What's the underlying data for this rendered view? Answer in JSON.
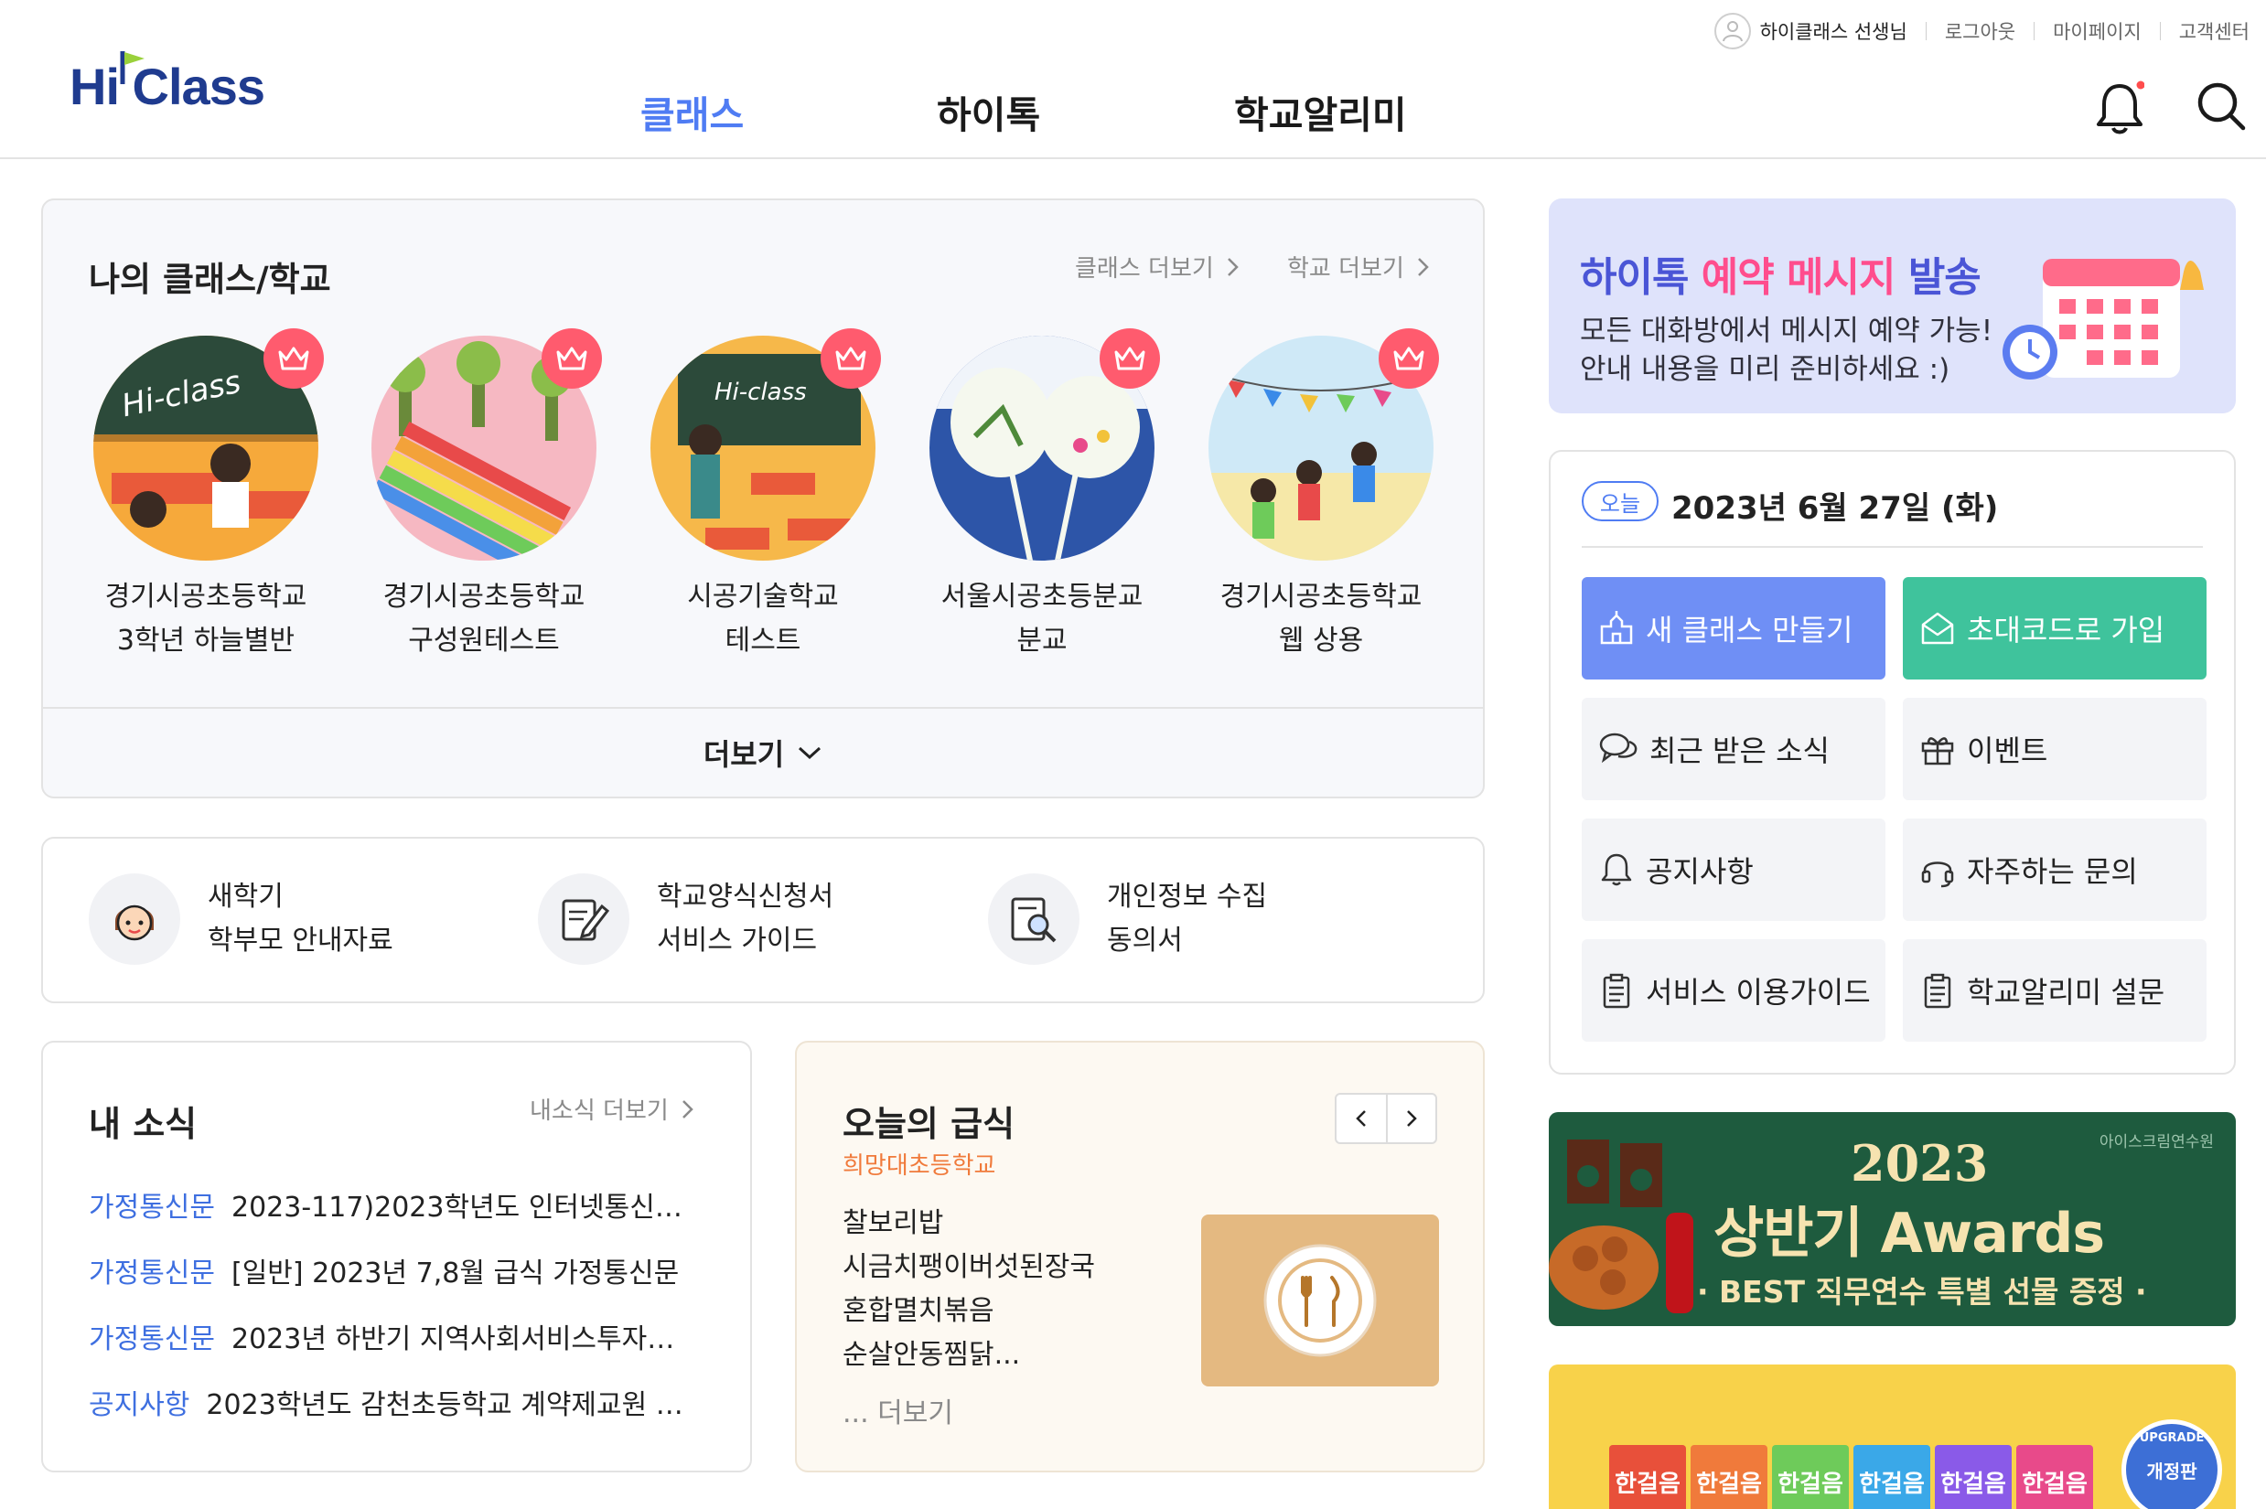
{
  "header": {
    "user": "하이클래스 선생님",
    "links": [
      "로그아웃",
      "마이페이지",
      "고객센터"
    ],
    "logo": "Hi Class",
    "nav": [
      "클래스",
      "하이톡",
      "학교알리미"
    ],
    "active_nav": "클래스"
  },
  "my_classes": {
    "title": "나의 클래스/학교",
    "class_more": "클래스 더보기",
    "school_more": "학교 더보기",
    "items": [
      {
        "line1": "경기시공초등학교",
        "line2": "3학년 하늘별반"
      },
      {
        "line1": "경기시공초등학교",
        "line2": "구성원테스트"
      },
      {
        "line1": "시공기술학교",
        "line2": "테스트"
      },
      {
        "line1": "서울시공초등분교",
        "line2": "분교"
      },
      {
        "line1": "경기시공초등학교",
        "line2": "웹 상용"
      }
    ],
    "more": "더보기",
    "art_text": [
      "Hi-class",
      "Hi-class"
    ]
  },
  "guides": [
    {
      "line1": "새학기",
      "line2": "학부모 안내자료",
      "icon": "face-icon"
    },
    {
      "line1": "학교양식신청서",
      "line2": "서비스 가이드",
      "icon": "form-edit-icon"
    },
    {
      "line1": "개인정보 수집",
      "line2": "동의서",
      "icon": "document-search-icon"
    }
  ],
  "news": {
    "title": "내 소식",
    "more": "내소식 더보기",
    "rows": [
      {
        "category": "가정통신문",
        "text": "2023-117)2023학년도 인터넷통신…"
      },
      {
        "category": "가정통신문",
        "text": "[일반] 2023년 7,8월 급식 가정통신문"
      },
      {
        "category": "가정통신문",
        "text": "2023년 하반기 지역사회서비스투자…"
      },
      {
        "category": "공지사항",
        "text": "2023학년도 감천초등학교 계약제교원 …"
      }
    ]
  },
  "meal": {
    "title": "오늘의 급식",
    "school": "희망대초등학교",
    "menu": [
      "찰보리밥",
      "시금치팽이버섯된장국",
      "혼합멸치볶음",
      "순살안동찜닭..."
    ],
    "more": "... 더보기"
  },
  "banner_reserve": {
    "title_a": "하이톡",
    "title_b": "예약 메시지",
    "title_c": "발송",
    "line1": "모든 대화방에서 메시지 예약 가능!",
    "line2": "안내 내용을 미리 준비하세요 :)"
  },
  "today": {
    "badge": "오늘",
    "date": "2023년 6월 27일 (화)",
    "buttons": [
      {
        "label": "새 클래스 만들기",
        "icon": "school-icon"
      },
      {
        "label": "초대코드로 가입",
        "icon": "mail-open-icon"
      },
      {
        "label": "최근 받은 소식",
        "icon": "chat-bubbles-icon"
      },
      {
        "label": "이벤트",
        "icon": "gift-icon"
      },
      {
        "label": "공지사항",
        "icon": "bell-icon"
      },
      {
        "label": "자주하는 문의",
        "icon": "headset-icon"
      },
      {
        "label": "서비스 이용가이드",
        "icon": "clipboard-icon"
      },
      {
        "label": "학교알리미 설문",
        "icon": "clipboard-icon"
      }
    ]
  },
  "banner_awards": {
    "org": "아이스크림연수원",
    "year": "2023",
    "title": "상반기 Awards",
    "subtitle": "· BEST 직무연수 특별 선물 증정 ·"
  },
  "banner_books": {
    "badge_top": "UPGRADE",
    "badge": "개정판",
    "book_text": "한걸음"
  },
  "colors": {
    "brand": "#1f3b8f",
    "accent": "#4f7cf3",
    "crown": "#ff5b6e",
    "news_category": "#3e6fe0",
    "meal_school": "#f07a3b",
    "btn_blue": "#6f8ff5",
    "btn_green": "#3fc39c"
  }
}
